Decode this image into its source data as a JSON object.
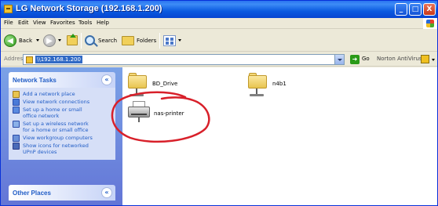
{
  "window": {
    "title": "LG Network Storage (192.168.1.200)",
    "controls": {
      "minimize": "_",
      "maximize": "□",
      "close": "X"
    }
  },
  "menu": [
    "File",
    "Edit",
    "View",
    "Favorites",
    "Tools",
    "Help"
  ],
  "toolbar": {
    "back_label": "Back",
    "search_label": "Search",
    "folders_label": "Folders"
  },
  "address": {
    "label": "Address",
    "value": "\\\\192.168.1.200",
    "go_label": "Go",
    "norton_label": "Norton AntiVirus"
  },
  "taskpane": {
    "network_tasks": {
      "title": "Network Tasks",
      "items": [
        {
          "label": "Add a network place",
          "icon": "add-network-place-icon"
        },
        {
          "label": "View network connections",
          "icon": "network-connections-icon"
        },
        {
          "label": "Set up a home or small office network",
          "line1": "Set up a home or small",
          "line2": "office network",
          "icon": "home-network-icon"
        },
        {
          "label": "Set up a wireless network for a home or small office",
          "line1": "Set up a wireless network",
          "line2": "for a home or small office",
          "icon": "wireless-network-icon"
        },
        {
          "label": "View workgroup computers",
          "icon": "workgroup-computers-icon"
        },
        {
          "label": "Show icons for networked UPnP devices",
          "line1": "Show icons for networked",
          "line2": "UPnP devices",
          "icon": "upnp-devices-icon"
        }
      ]
    },
    "other_places": {
      "title": "Other Places"
    }
  },
  "content": {
    "items": [
      {
        "name": "BD_Drive",
        "type": "shared-folder"
      },
      {
        "name": "n4b1",
        "type": "shared-folder"
      },
      {
        "name": "nas-printer",
        "type": "printer"
      }
    ]
  },
  "colors": {
    "titlebar": "#0a5ae0",
    "taskpane": "#7ba2e7",
    "link": "#215dc6",
    "annotation": "#d8202a",
    "selection": "#316ac5"
  }
}
